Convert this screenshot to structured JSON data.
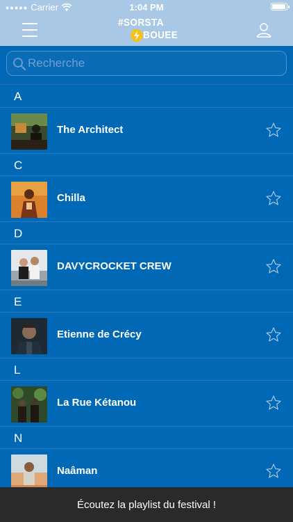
{
  "status_bar": {
    "carrier": "Carrier",
    "time": "1:04 PM"
  },
  "nav": {
    "logo_line1": "#SORSTA",
    "logo_line2": "BOUEE",
    "menu_icon": "hamburger-icon",
    "profile_icon": "user-icon"
  },
  "search": {
    "placeholder": "Recherche",
    "value": ""
  },
  "sections": [
    {
      "letter": "A",
      "artist": "The Architect"
    },
    {
      "letter": "C",
      "artist": "Chilla"
    },
    {
      "letter": "D",
      "artist": "DAVYCROCKET CREW"
    },
    {
      "letter": "E",
      "artist": "Etienne de Crécy"
    },
    {
      "letter": "L",
      "artist": "La Rue Kétanou"
    },
    {
      "letter": "N",
      "artist": "Naâman"
    }
  ],
  "footer": {
    "label": "Écoutez la playlist du festival !"
  },
  "colors": {
    "header_bg": "#a9c8e6",
    "list_bg": "#0068b4",
    "footer_bg": "#2a2a2a",
    "star": "#a9c8e6",
    "logo_accent": "#f5c11b"
  }
}
